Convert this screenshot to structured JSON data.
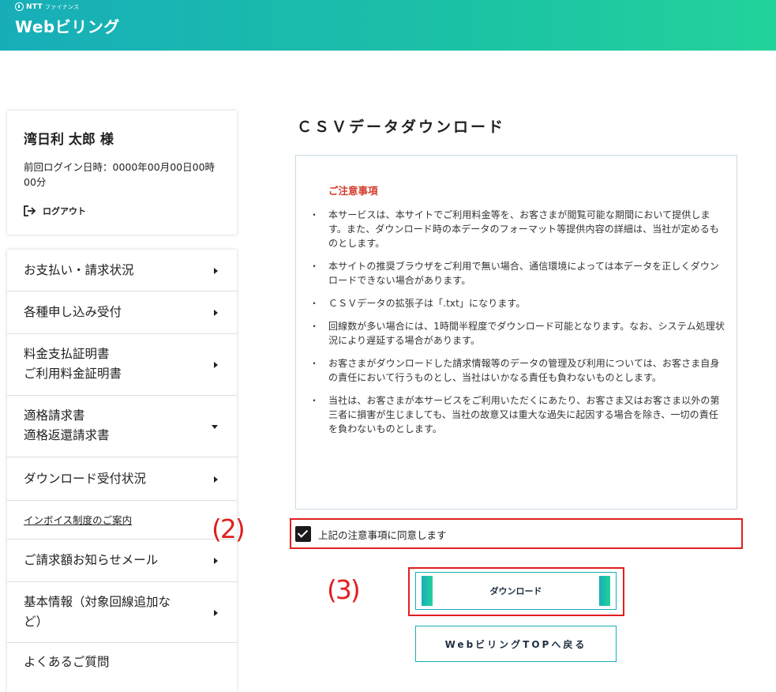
{
  "header": {
    "brand_small": "NTT",
    "brand_sub": "ファイナンス",
    "brand_main": "Webビリング"
  },
  "user": {
    "name": "湾日利 太郎 様",
    "last_login": "前回ログイン日時：0000年00月00日00時00分",
    "logout_label": "ログアウト"
  },
  "menu": {
    "items": [
      {
        "label": "お支払い・請求状況"
      },
      {
        "label": "各種申し込み受付"
      },
      {
        "label": "料金支払証明書\nご利用料金証明書"
      },
      {
        "label": "適格請求書\n適格返還請求書"
      },
      {
        "label": "ダウンロード受付状況"
      },
      {
        "label": "インボイス制度のご案内"
      },
      {
        "label": "ご請求額お知らせメール"
      },
      {
        "label": "基本情報（対象回線追加な\nど）"
      },
      {
        "label": "よくあるご質問"
      }
    ]
  },
  "main": {
    "title": "ＣＳＶデータダウンロード",
    "notice_title": "ご注意事項",
    "notices": [
      "本サービスは、本サイトでご利用料金等を、お客さまが閲覧可能な期間において提供します。また、ダウンロード時の本データのフォーマット等提供内容の詳細は、当社が定めるものとします。",
      "本サイトの推奨ブラウザをご利用で無い場合、通信環境によっては本データを正しくダウンロードできない場合があります。",
      "ＣＳＶデータの拡張子は「.txt」になります。",
      "回線数が多い場合には、1時間半程度でダウンロード可能となります。なお、システム処理状況により遅延する場合があります。",
      "お客さまがダウンロードした請求情報等のデータの管理及び利用については、お客さま自身の責任において行うものとし、当社はいかなる責任も負わないものとします。",
      "当社は、お客さまが本サービスをご利用いただくにあたり、お客さま又はお客さま以外の第三者に損害が生じましても、当社の故意又は重大な過失に起因する場合を除き、一切の責任を負わないものとします。"
    ],
    "agree_label": "上記の注意事項に同意します",
    "agree_checked": true,
    "download_label": "ダウンロード",
    "back_label": "WebビリングTOPへ戻る"
  },
  "annotations": {
    "step2": "(2)",
    "step3": "(3)"
  },
  "colors": {
    "header_gradient_start": "#17aeb9",
    "header_gradient_end": "#22d39a",
    "notice_title": "#d33b2a",
    "annotation_red": "#e02020"
  }
}
